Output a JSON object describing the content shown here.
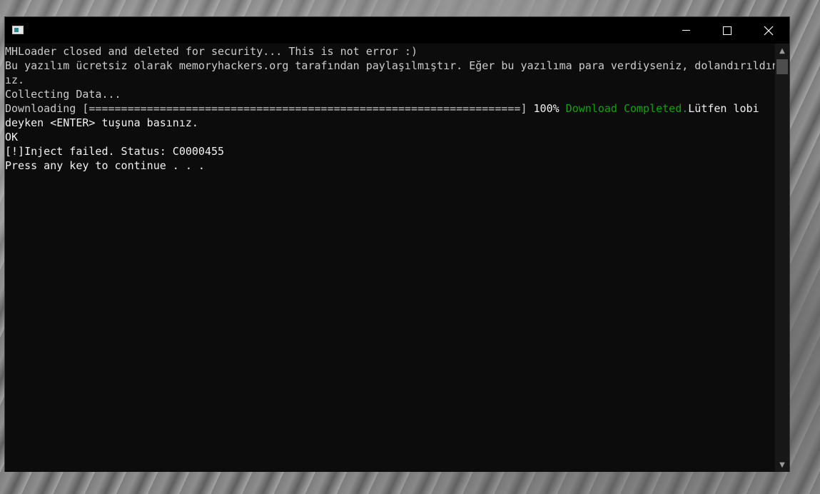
{
  "window": {
    "title": "",
    "buttons": {
      "minimize": "minimize-icon",
      "maximize": "maximize-icon",
      "close": "close-icon"
    }
  },
  "console": {
    "lines": [
      "MHLoader closed and deleted for security... This is not error :)",
      "Bu yazılım ücretsiz olarak memoryhackers.org tarafından paylaşılmıştır. Eğer bu yazılıma para verdiyseniz, dolandırıldın",
      "ız.",
      "Collecting Data..."
    ],
    "download": {
      "prefix": "Downloading [===================================================================]",
      "percent": " 100%",
      "completed": " Download Completed.",
      "suffix": "Lütfen lobi"
    },
    "lines_after": [
      "deyken <ENTER> tuşuna basınız.",
      "OK",
      "[!]Inject failed. Status: C0000455",
      "Press any key to continue . . ."
    ],
    "colors": {
      "text": "#cccccc",
      "success": "#13a10e",
      "background": "#0c0c0c"
    }
  },
  "scrollbar": {
    "up": "▲",
    "down": "▼"
  }
}
